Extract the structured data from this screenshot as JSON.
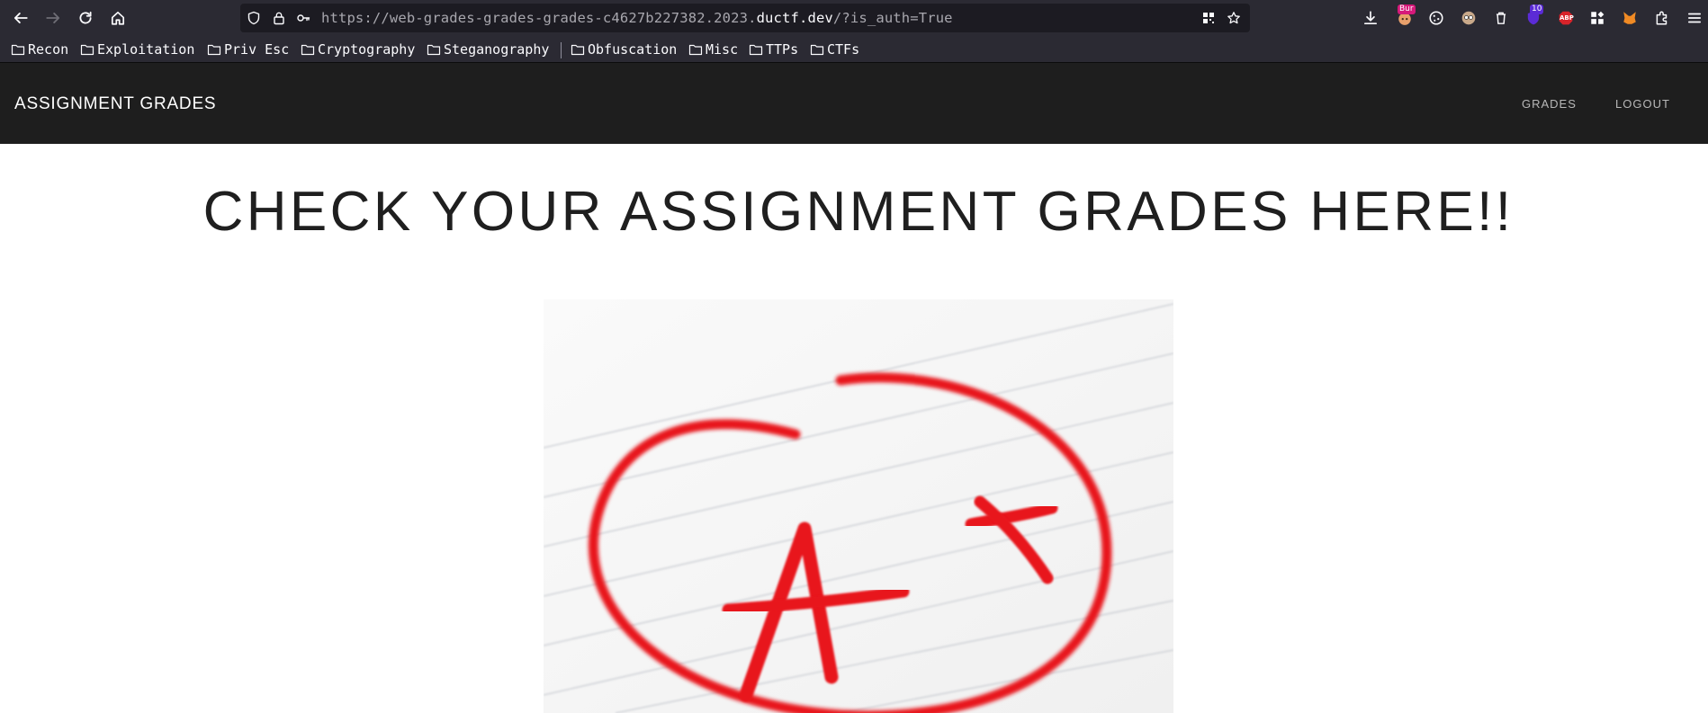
{
  "browser": {
    "url_prefix": "https://web-grades-grades-grades-c4627b227382.2023.",
    "url_domain": "ductf.dev",
    "url_suffix": "/?is_auth=True",
    "extensions": {
      "burp_badge": "Bur",
      "ublock_badge": "10",
      "abp_label": "ABP"
    }
  },
  "bookmarks": [
    {
      "label": "Recon"
    },
    {
      "label": "Exploitation"
    },
    {
      "label": "Priv Esc"
    },
    {
      "label": "Cryptography"
    },
    {
      "label": "Steganography"
    },
    {
      "label": "Obfuscation"
    },
    {
      "label": "Misc"
    },
    {
      "label": "TTPs"
    },
    {
      "label": "CTFs"
    }
  ],
  "site": {
    "brand": "ASSIGNMENT GRADES",
    "nav": {
      "grades": "GRADES",
      "logout": "LOGOUT"
    },
    "headline": "CHECK YOUR ASSIGNMENT GRADES HERE!!",
    "hero_image_text": "A+"
  },
  "colors": {
    "browser_chrome": "#2b2a33",
    "urlbar": "#1c1b22",
    "site_navbar": "#1e1e1e",
    "grade_red": "#e8191b"
  }
}
